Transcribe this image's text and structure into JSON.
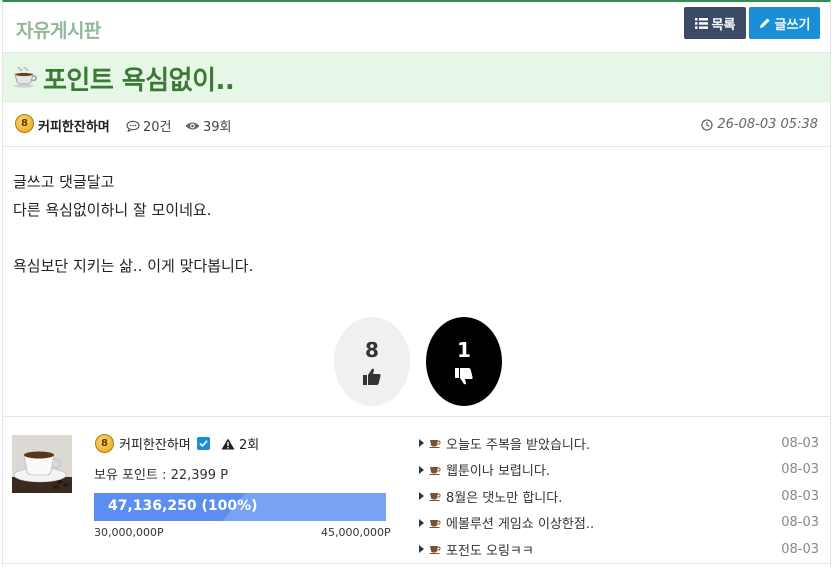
{
  "header": {
    "board_name": "자유게시판",
    "list_button": "목록",
    "write_button": "글쓰기"
  },
  "post": {
    "title": "포인트 욕심없이..",
    "author": "커피한잔하며",
    "author_level": "8",
    "comments": "20건",
    "views": "39회",
    "date": "26-08-03 05:38",
    "content": [
      "글쓰고 댓글달고",
      "다른 욕심없이하니 잘 모이네요.",
      "",
      "욕심보단 지키는 삶.. 이게 맞다봅니다."
    ]
  },
  "votes": {
    "up": "8",
    "down": "1"
  },
  "profile": {
    "name": "커피한잔하며",
    "level": "8",
    "warnings": "2회",
    "points": "보유 포인트 : 22,399 P",
    "progress_label": "47,136,250 (100%)",
    "progress_fraction": 1.0,
    "progress_min": "30,000,000P",
    "progress_max": "45,000,000P"
  },
  "related_posts": [
    {
      "title": "오늘도 주복을 받았습니다.",
      "date": "08-03"
    },
    {
      "title": "웹툰이나 보렵니다.",
      "date": "08-03"
    },
    {
      "title": "8월은 댓노만 합니다.",
      "date": "08-03"
    },
    {
      "title": "에볼루션 게임쇼 이상한점..",
      "date": "08-03"
    },
    {
      "title": "포전도 오링ㅋㅋ",
      "date": "08-03"
    }
  ],
  "colors": {
    "accent_green": "#3a7a33",
    "title_bg": "#e6f7e8",
    "list_button_bg": "#3d4a66",
    "write_button_bg": "#1a8fd8",
    "progress_bar": "#5b8ef0"
  },
  "icons": {
    "list": "list-icon",
    "write": "pencil-icon",
    "cup": "coffee-cup-icon",
    "comment": "comment-icon",
    "views": "eye-icon",
    "clock": "clock-icon",
    "thumbs_up": "thumbs-up-icon",
    "thumbs_down": "thumbs-down-icon",
    "verified": "check-icon",
    "warning": "warning-icon"
  }
}
